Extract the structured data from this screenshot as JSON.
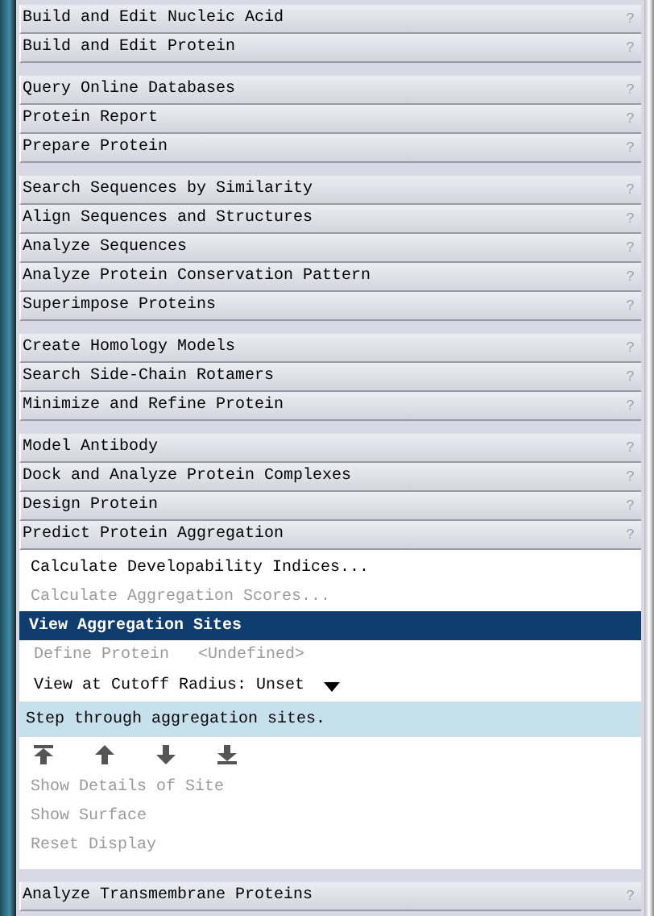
{
  "groups": [
    {
      "tools": [
        {
          "label": "Build and Edit Nucleic Acid",
          "help": "?"
        },
        {
          "label": "Build and Edit Protein",
          "help": "?"
        }
      ]
    },
    {
      "tools": [
        {
          "label": "Query Online Databases",
          "help": "?"
        },
        {
          "label": "Protein Report",
          "help": "?"
        },
        {
          "label": "Prepare Protein",
          "help": "?"
        }
      ]
    },
    {
      "tools": [
        {
          "label": "Search Sequences by Similarity",
          "help": "?"
        },
        {
          "label": "Align Sequences and Structures",
          "help": "?"
        },
        {
          "label": "Analyze Sequences",
          "help": "?"
        },
        {
          "label": "Analyze Protein Conservation Pattern",
          "help": "?"
        },
        {
          "label": "Superimpose Proteins",
          "help": "?"
        }
      ]
    },
    {
      "tools": [
        {
          "label": "Create Homology Models",
          "help": "?"
        },
        {
          "label": "Search Side-Chain Rotamers",
          "help": "?"
        },
        {
          "label": "Minimize and Refine Protein",
          "help": "?"
        }
      ]
    },
    {
      "tools": [
        {
          "label": "Model Antibody",
          "help": "?"
        },
        {
          "label": "Dock and Analyze Protein Complexes",
          "help": "?"
        },
        {
          "label": "Design Protein",
          "help": "?"
        },
        {
          "label": "Predict Protein Aggregation",
          "help": "?",
          "panel": [
            {
              "kind": "command",
              "label": "Calculate Developability Indices...",
              "disabled": false,
              "selected": false
            },
            {
              "kind": "command",
              "label": "Calculate Aggregation Scores...",
              "disabled": true,
              "selected": false
            },
            {
              "kind": "command",
              "label": "View Aggregation Sites",
              "disabled": false,
              "selected": true
            },
            {
              "kind": "field",
              "label": "Define Protein",
              "value": "<Undefined>",
              "disabled": true
            },
            {
              "kind": "dropdown",
              "label": "View at Cutoff Radius:",
              "value": "Unset",
              "disabled": false
            },
            {
              "kind": "hint",
              "text": "Step through aggregation sites."
            },
            {
              "kind": "nav"
            },
            {
              "kind": "command",
              "label": "Show Details of Site",
              "disabled": true,
              "selected": false
            },
            {
              "kind": "command",
              "label": "Show Surface",
              "disabled": true,
              "selected": false
            },
            {
              "kind": "command",
              "label": "Reset Display",
              "disabled": true,
              "selected": false
            }
          ]
        }
      ]
    },
    {
      "tools": [
        {
          "label": "Analyze Transmembrane Proteins",
          "help": "?"
        }
      ]
    }
  ]
}
